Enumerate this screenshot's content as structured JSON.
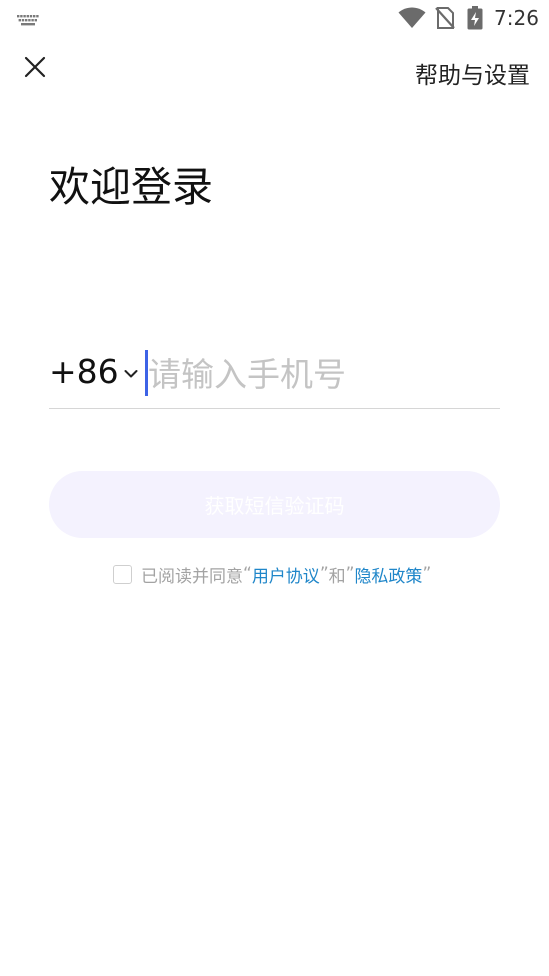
{
  "status_bar": {
    "time": "7:26",
    "icons": [
      "keyboard-icon",
      "wifi-icon",
      "no-sim-icon",
      "battery-charging-icon"
    ]
  },
  "top_bar": {
    "close_icon": "close-icon",
    "help_label": "帮助与设置"
  },
  "title": "欢迎登录",
  "phone_form": {
    "country_code": "+86",
    "phone_value": "",
    "phone_placeholder": "请输入手机号",
    "submit_label": "获取短信验证码"
  },
  "agreement": {
    "prefix": "已阅读并同意",
    "quote_open_1": "“",
    "user_agreement": "用户协议",
    "quote_close_1": "”",
    "conj": "和",
    "quote_open_2": "”",
    "privacy_policy": "隐私政策",
    "quote_close_2": "”",
    "checked": false
  },
  "colors": {
    "accent": "#3d63e6",
    "link": "#1f86c9",
    "button_bg": "#f4f2fe",
    "placeholder": "#c4c4c4"
  }
}
